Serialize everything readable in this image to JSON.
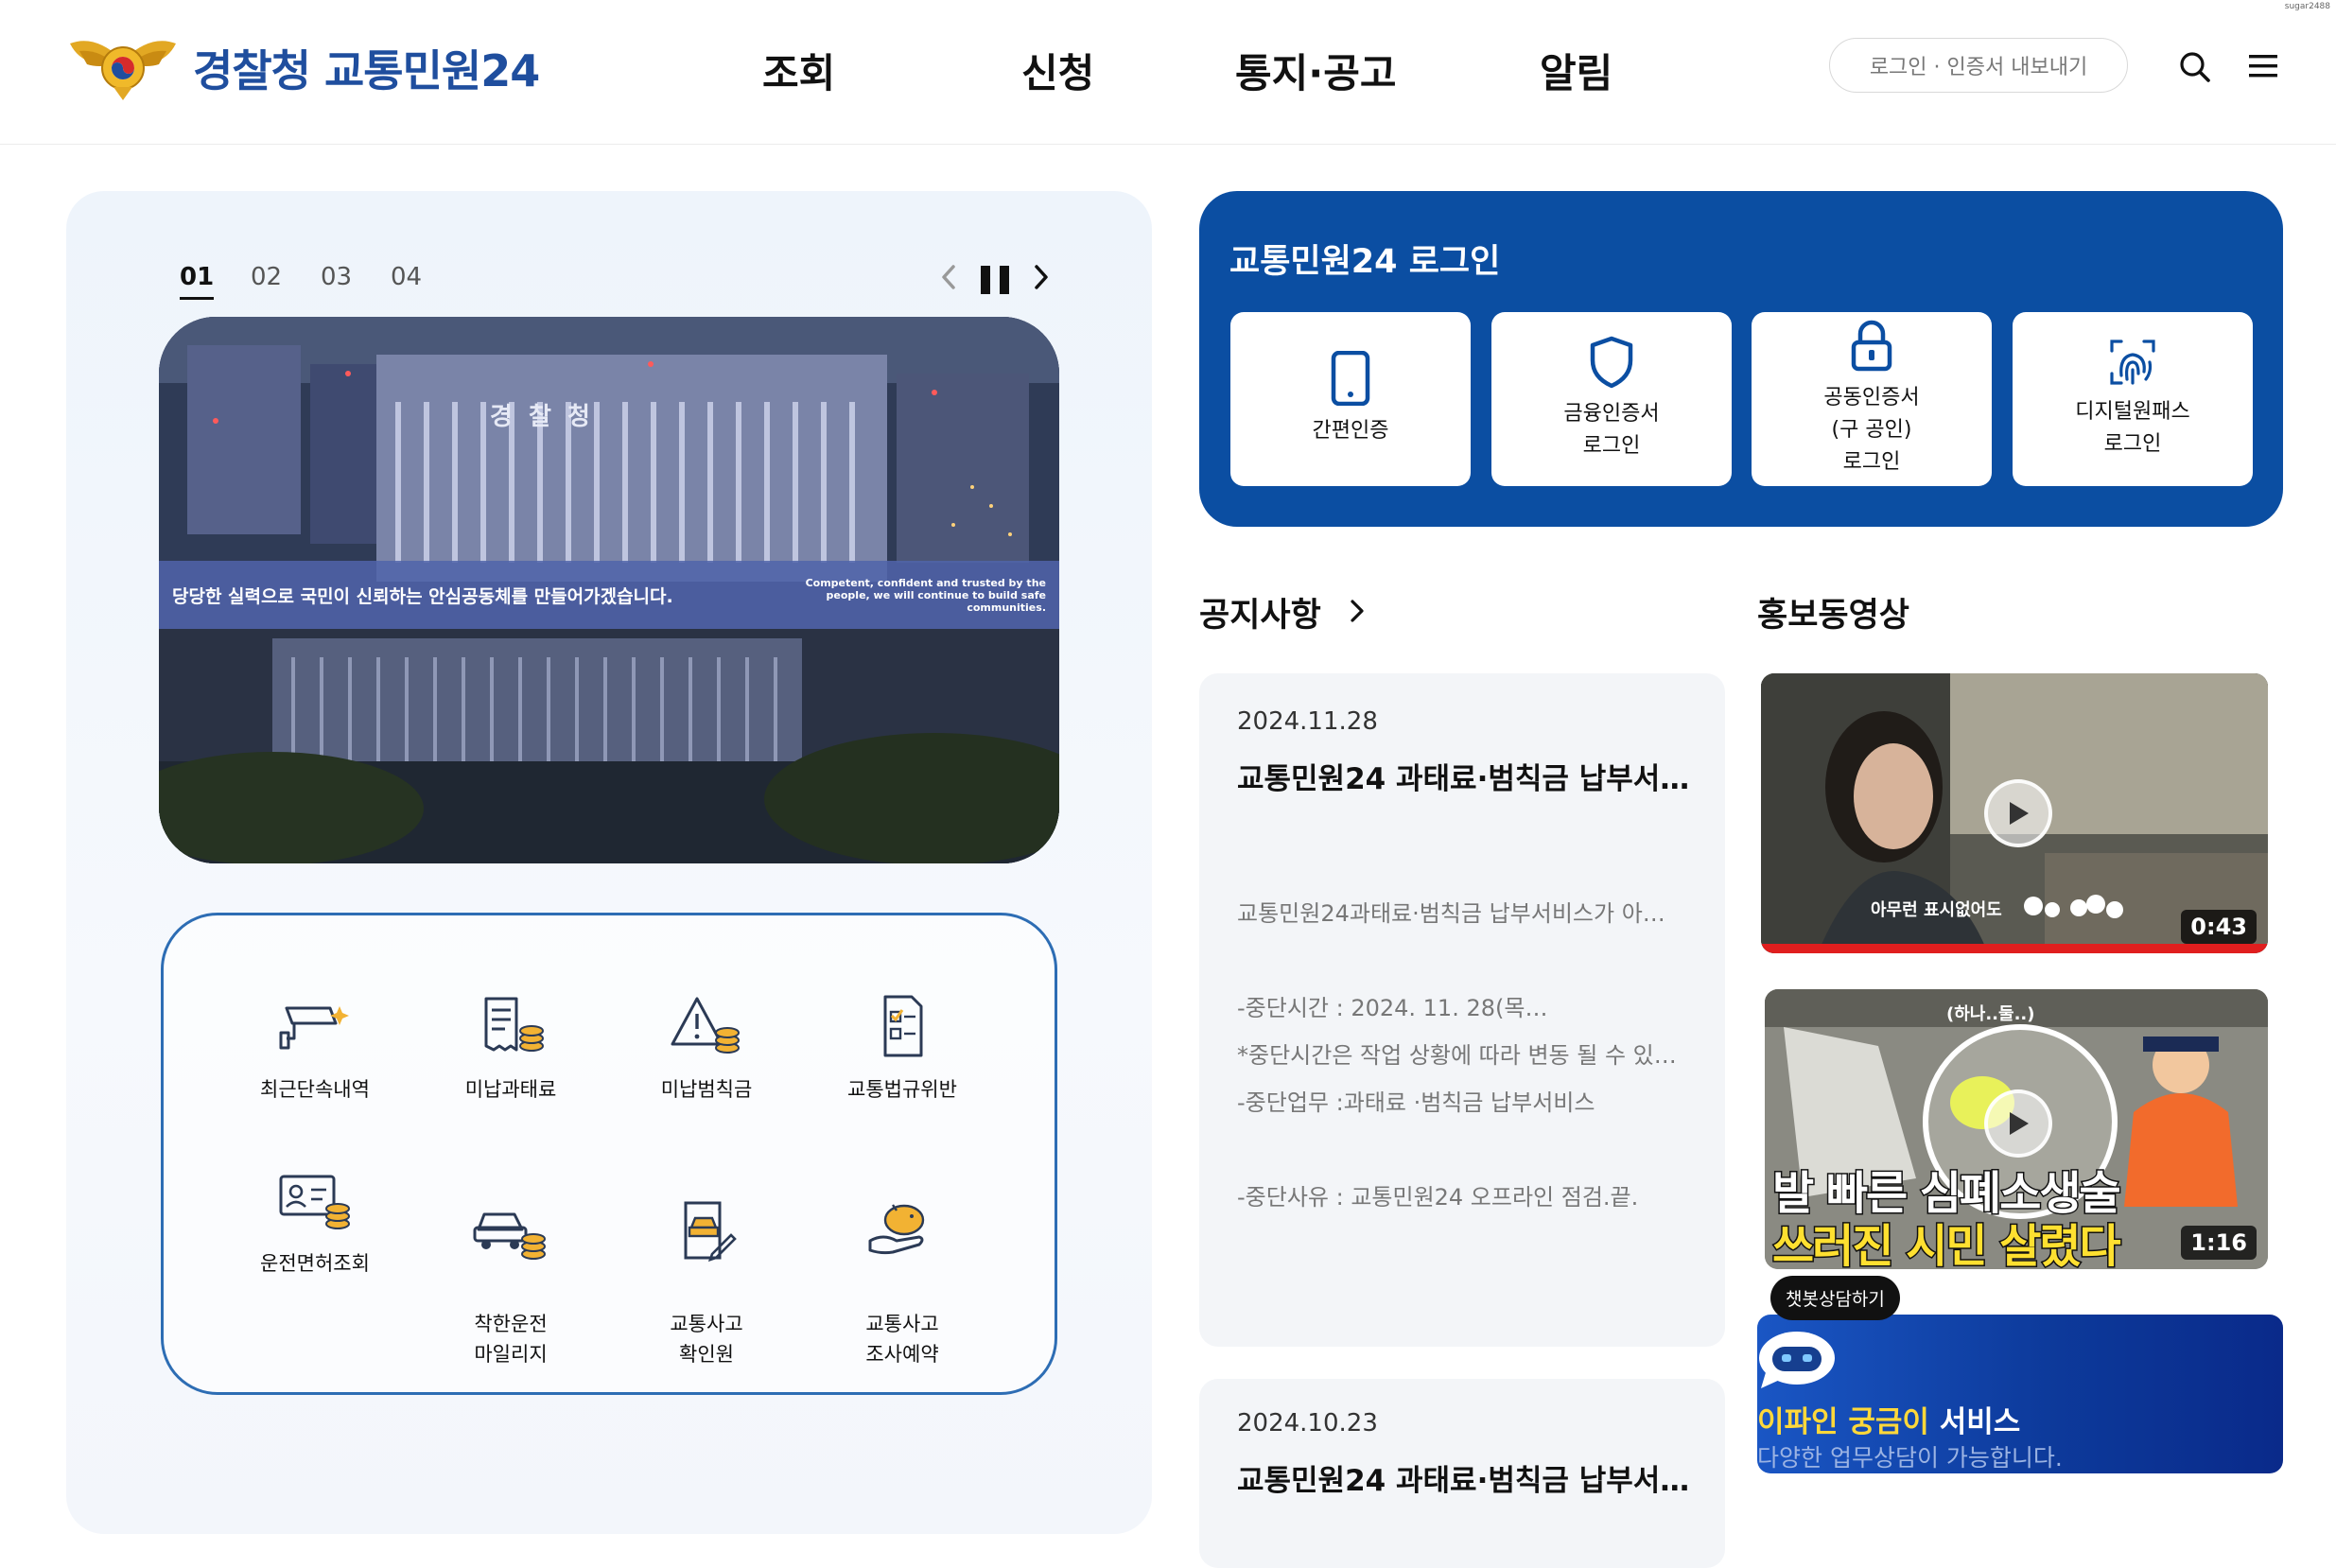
{
  "header": {
    "brand": "경찰청 교통민원24",
    "nav": [
      "조회",
      "신청",
      "통지·공고",
      "알림"
    ],
    "login_button": "로그인 · 인증서 내보내기",
    "corner_tag": "sugar2488"
  },
  "slider": {
    "pages": [
      "01",
      "02",
      "03",
      "04"
    ],
    "active_page": "01",
    "banner_ko": "당당한 실력으로 국민이 신뢰하는 안심공동체를 만들어가겠습니다.",
    "banner_en": "Competent, confident and trusted by the people, we will continue to build safe communities.",
    "building_sign": "경  찰  청"
  },
  "quick_menu": [
    {
      "label": "최근단속내역",
      "icon": "cctv-icon"
    },
    {
      "label": "미납과태료",
      "icon": "receipt-coins-icon"
    },
    {
      "label": "미납범칙금",
      "icon": "warning-coins-icon"
    },
    {
      "label": "교통법규위반",
      "icon": "document-check-icon"
    },
    {
      "label": "운전면허조회",
      "icon": "license-card-icon"
    },
    {
      "label": "착한운전\n마일리지",
      "icon": "car-coins-icon"
    },
    {
      "label": "교통사고\n확인원",
      "icon": "accident-document-icon"
    },
    {
      "label": "교통사고\n조사예약",
      "icon": "piggy-hand-icon"
    }
  ],
  "login": {
    "title": "교통민원24 로그인",
    "options": [
      {
        "label": "간편인증",
        "icon": "phone-icon"
      },
      {
        "label": "금융인증서\n로그인",
        "icon": "shield-icon"
      },
      {
        "label": "공동인증서\n(구 공인)\n로그인",
        "icon": "lock-icon"
      },
      {
        "label": "디지털원패스\n로그인",
        "icon": "fingerprint-icon"
      }
    ]
  },
  "notice": {
    "title": "공지사항",
    "items": [
      {
        "date": "2024.11.28",
        "title": "교통민원24 과태료·범칙금 납부서…",
        "lines": [
          "교통민원24과태료·범칙금 납부서비스가 아…",
          "",
          "-중단시간 : 2024. 11. 28(목…",
          "*중단시간은 작업 상황에 따라 변동 될 수 있…",
          "-중단업무 :과태료 ·범칙금 납부서비스",
          "",
          "-중단사유 : 교통민원24 오프라인 점검.끝."
        ]
      },
      {
        "date": "2024.10.23",
        "title": "교통민원24 과태료·범칙금 납부서…"
      }
    ]
  },
  "videos": {
    "title": "홍보동영상",
    "items": [
      {
        "duration": "0:43",
        "caption": "아무런 표시없어도"
      },
      {
        "duration": "1:16",
        "caption_top": "발 빠른 심폐소생술",
        "caption_bottom": "쓰러진 시민 살렸다",
        "small": "(하나..둘..)"
      }
    ]
  },
  "chatbot": {
    "bubble": "챗봇상담하기",
    "title_highlight": "이파인 궁금이",
    "title_rest": " 서비스",
    "subtitle": "다양한 업무상담이 가능합니다."
  },
  "colors": {
    "brand_blue": "#0b4ea2",
    "logo_blue": "#1f4e9e",
    "quick_border": "#2d6db4",
    "chat_yellow": "#ffd83a"
  }
}
